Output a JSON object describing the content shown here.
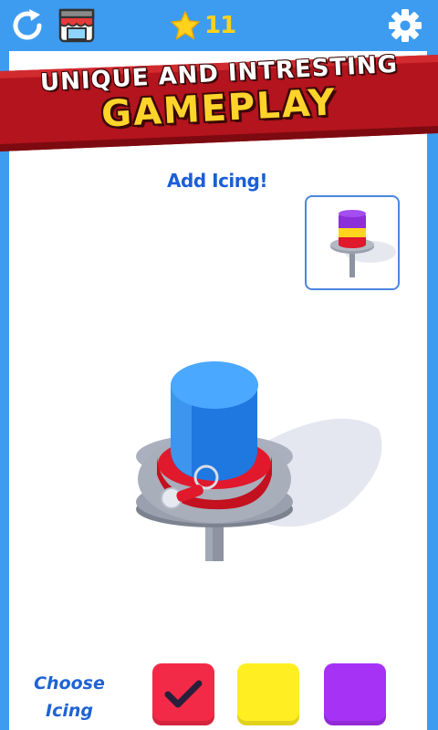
{
  "hud": {
    "star_count": "11",
    "colors": {
      "star": "#ffd21c",
      "background": "#3d9cf0"
    }
  },
  "banner": {
    "line1": "UNIQUE AND INTRESTING",
    "line2": "GAMEPLAY",
    "colors": {
      "ribbon": "#b3141d",
      "line1_text": "#ffffff",
      "line2_text": "#ffd42a"
    }
  },
  "game": {
    "instruction": "Add Icing!",
    "target_preview": {
      "layers": [
        "purple",
        "yellow",
        "red"
      ]
    },
    "cake": {
      "top_color": "#2f8ff0",
      "icing_color": "#e0192c",
      "plate_color": "#9aa0ad"
    }
  },
  "icing_picker": {
    "label_line1": "Choose",
    "label_line2": "Icing",
    "options": [
      {
        "name": "red",
        "color": "#f32a47",
        "selected": true
      },
      {
        "name": "yellow",
        "color": "#ffef22",
        "selected": false
      },
      {
        "name": "purple",
        "color": "#a532f5",
        "selected": false
      }
    ],
    "selected_icon": "check-icon"
  }
}
